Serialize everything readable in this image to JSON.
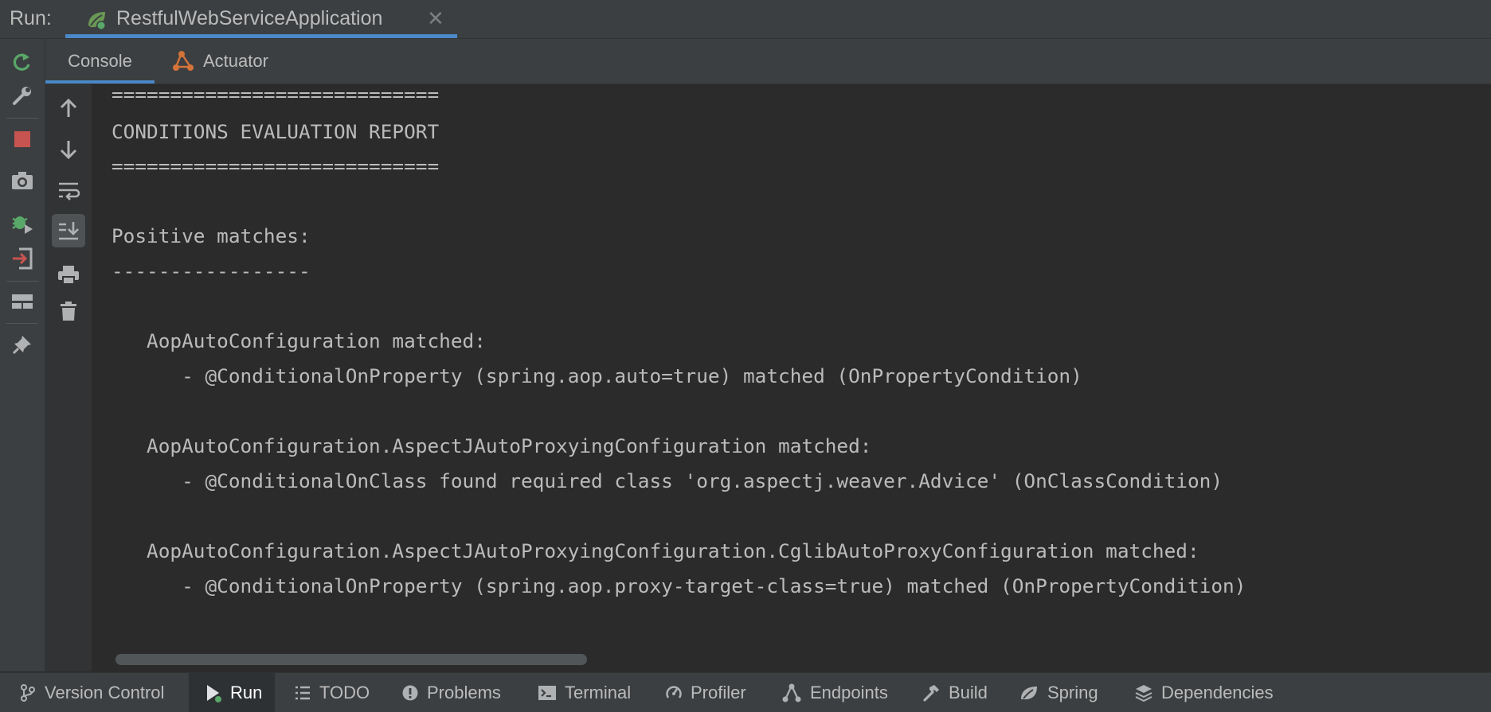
{
  "runbar": {
    "label": "Run:",
    "tab_title": "RestfulWebServiceApplication",
    "tab_icon": "spring-boot-run-icon",
    "close_glyph": "✕"
  },
  "tabs": [
    {
      "label": "Console",
      "active": true
    },
    {
      "label": "Actuator",
      "icon": "actuator-icon",
      "active": false
    }
  ],
  "left_toolbar": [
    "rerun-icon",
    "wrench-icon",
    "stop-icon",
    "camera-icon",
    "debug-attach-icon",
    "exit-icon",
    "layout-icon",
    "pin-icon"
  ],
  "console_toolbar": [
    "up-arrow-icon",
    "down-arrow-icon",
    "soft-wrap-icon",
    "scroll-to-end-icon",
    "print-icon",
    "trash-icon"
  ],
  "console": {
    "lines": [
      "============================",
      "CONDITIONS EVALUATION REPORT",
      "============================",
      "",
      "",
      "Positive matches:",
      "-----------------",
      "",
      "   AopAutoConfiguration matched:",
      "      - @ConditionalOnProperty (spring.aop.auto=true) matched (OnPropertyCondition)",
      "",
      "   AopAutoConfiguration.AspectJAutoProxyingConfiguration matched:",
      "      - @ConditionalOnClass found required class 'org.aspectj.weaver.Advice' (OnClassCondition)",
      "",
      "   AopAutoConfiguration.AspectJAutoProxyingConfiguration.CglibAutoProxyConfiguration matched:",
      "      - @ConditionalOnProperty (spring.aop.proxy-target-class=true) matched (OnPropertyCondition)"
    ]
  },
  "bottombar": {
    "items": [
      {
        "label": "Version Control",
        "icon": "branch-icon"
      },
      {
        "label": "Run",
        "icon": "play-icon",
        "active": true
      },
      {
        "label": "TODO",
        "icon": "list-icon"
      },
      {
        "label": "Problems",
        "icon": "warning-icon"
      },
      {
        "label": "Terminal",
        "icon": "terminal-icon"
      },
      {
        "label": "Profiler",
        "icon": "profiler-icon"
      },
      {
        "label": "Endpoints",
        "icon": "endpoints-icon"
      },
      {
        "label": "Build",
        "icon": "hammer-icon"
      },
      {
        "label": "Spring",
        "icon": "spring-leaf-icon"
      },
      {
        "label": "Dependencies",
        "icon": "layers-icon"
      }
    ]
  },
  "colors": {
    "accent": "#4a88c7",
    "stop": "#c75450",
    "run_green": "#499c54",
    "actuator_orange": "#d4733a"
  }
}
